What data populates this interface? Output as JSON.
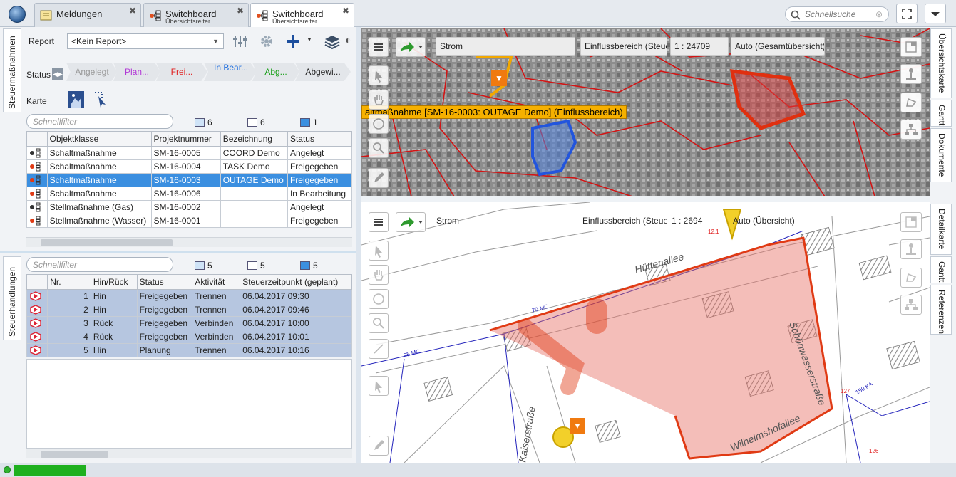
{
  "tabs": [
    {
      "title": "Meldungen",
      "subtitle": ""
    },
    {
      "title": "Switchboard",
      "subtitle": "Übersichtsreiter"
    },
    {
      "title": "Switchboard",
      "subtitle": "Übersichtsreiter"
    }
  ],
  "search": {
    "placeholder": "Schnellsuche"
  },
  "left": {
    "vtab_top": "Steuermaßnahmen",
    "vtab_bottom": "Steuerhandlungen",
    "report_label": "Report",
    "report_value": "<Kein Report>",
    "status_label": "Status",
    "status_steps": [
      {
        "label": "Angelegt",
        "color": "#9a9a9a"
      },
      {
        "label": "Plan...",
        "color": "#b23ad6"
      },
      {
        "label": "Frei...",
        "color": "#e02020"
      },
      {
        "label": "In Bear...",
        "color": "#1e6fe0"
      },
      {
        "label": "Abg...",
        "color": "#1aa01a"
      },
      {
        "label": "Abgewi...",
        "color": "#222222"
      }
    ],
    "karte_label": "Karte",
    "filter1": {
      "placeholder": "Schnellfilter",
      "counts": [
        "6",
        "6",
        "1"
      ]
    },
    "table1": {
      "headers": [
        "Objektklasse",
        "Projektnummer",
        "Bezeichnung",
        "Status"
      ],
      "rows": [
        [
          "Schaltmaßnahme",
          "SM-16-0005",
          "COORD Demo",
          "Angelegt"
        ],
        [
          "Schaltmaßnahme",
          "SM-16-0004",
          "TASK Demo",
          "Freigegeben"
        ],
        [
          "Schaltmaßnahme",
          "SM-16-0003",
          "OUTAGE Demo",
          "Freigegeben"
        ],
        [
          "Schaltmaßnahme",
          "SM-16-0006",
          "",
          "In Bearbeitung"
        ],
        [
          "Stellmaßnahme (Gas)",
          "SM-16-0002",
          "",
          "Angelegt"
        ],
        [
          "Stellmaßnahme (Wasser)",
          "SM-16-0001",
          "",
          "Freigegeben"
        ]
      ]
    },
    "filter2": {
      "placeholder": "Schnellfilter",
      "counts": [
        "5",
        "5",
        "5"
      ]
    },
    "table2": {
      "headers": [
        "Nr.",
        "Hin/Rück",
        "Status",
        "Aktivität",
        "Steuerzeitpunkt (geplant)"
      ],
      "rows": [
        [
          "1",
          "Hin",
          "Freigegeben",
          "Trennen",
          "06.04.2017 09:30"
        ],
        [
          "2",
          "Hin",
          "Freigegeben",
          "Trennen",
          "06.04.2017 09:46"
        ],
        [
          "3",
          "Rück",
          "Freigegeben",
          "Verbinden",
          "06.04.2017 10:00"
        ],
        [
          "4",
          "Rück",
          "Freigegeben",
          "Verbinden",
          "06.04.2017 10:01"
        ],
        [
          "5",
          "Hin",
          "Planung",
          "Trennen",
          "06.04.2017 10:16"
        ]
      ]
    }
  },
  "map_top": {
    "layer": "Strom",
    "mode": "Einflussbereich (Steue",
    "scale": "1 : 24709",
    "zoom": "Auto (Gesamtübersicht)",
    "banner": "altmaßnahme [SM-16-0003: OUTAGE Demo] (Einflussbereich)",
    "side_tabs": [
      "Übersichtskarte",
      "Gantt",
      "Dokumente"
    ]
  },
  "map_bottom": {
    "layer": "Strom",
    "mode": "Einflussbereich (Steue",
    "scale": "1 : 2694",
    "zoom": "Auto (Übersicht)",
    "side_tabs": [
      "Detailkarte",
      "Gantt",
      "Referenzen"
    ],
    "labels": [
      "Hüttenallee",
      "Schönwasserstraße",
      "Wilhelmshofallee",
      "Kaiserstraße",
      "70 MC",
      "95 MC",
      "150 KA",
      "127",
      "126",
      "12.1"
    ]
  }
}
